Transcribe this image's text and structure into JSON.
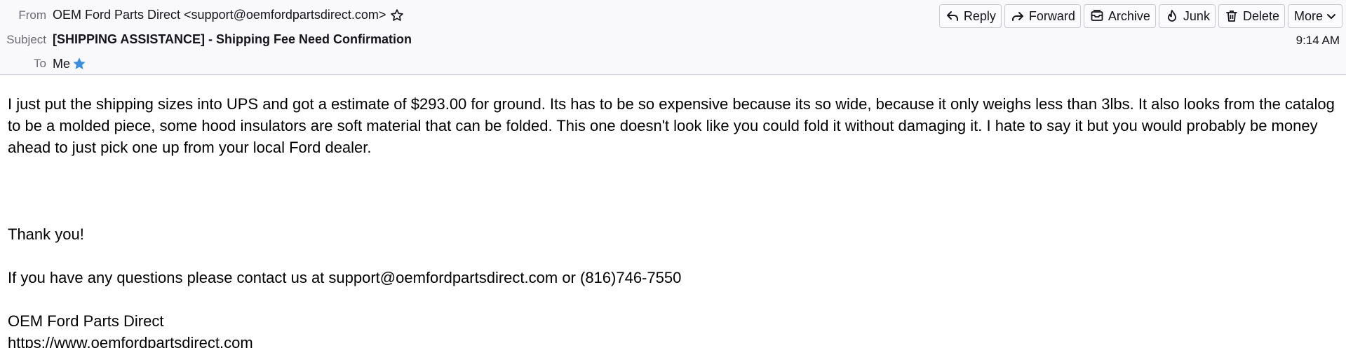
{
  "header": {
    "from_label": "From",
    "from_value": "OEM Ford Parts Direct <support@oemfordpartsdirect.com>",
    "subject_label": "Subject",
    "subject_value": "[SHIPPING ASSISTANCE] - Shipping Fee Need Confirmation",
    "to_label": "To",
    "to_value": "Me",
    "time": "9:14 AM"
  },
  "toolbar": {
    "reply": "Reply",
    "forward": "Forward",
    "archive": "Archive",
    "junk": "Junk",
    "delete": "Delete",
    "more": "More"
  },
  "message": {
    "paragraph1": "I just put the shipping sizes into UPS and got a estimate of $293.00 for ground. Its has to be so expensive because its so wide, because it only weighs less than 3lbs. It also looks from the catalog to be a molded piece, some hood insulators are soft material that can be folded. This one doesn't look like you could fold it without damaging it. I hate to say it but you would probably be money ahead to just pick one up from your local Ford dealer.",
    "thanks": "Thank you!",
    "contact": "If you have any questions please contact us at support@oemfordpartsdirect.com or (816)746-7550",
    "signature_name": "OEM Ford Parts Direct",
    "signature_url": "https://www.oemfordpartsdirect.com"
  },
  "colors": {
    "header_bg": "#f9f9fb",
    "label": "#6b6b74",
    "star_filled": "#3b8fe0"
  }
}
